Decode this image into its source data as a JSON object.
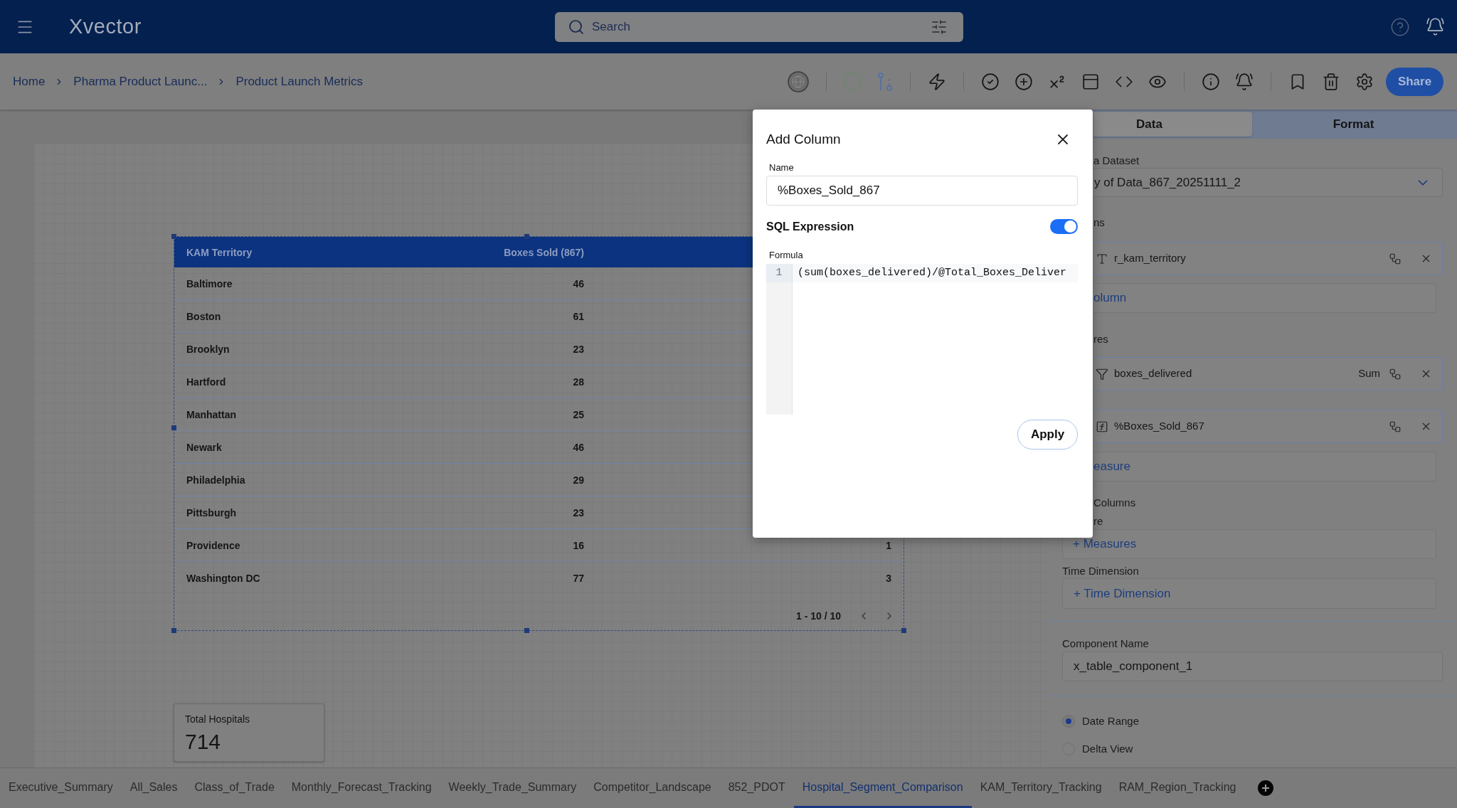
{
  "top_bar": {
    "logo": "Xvector",
    "search": {
      "placeholder": "Search"
    }
  },
  "breadcrumbs": [
    {
      "label": "Home"
    },
    {
      "label": "Pharma Product Launc..."
    },
    {
      "label": "Product Launch Metrics"
    }
  ],
  "toolbar": {
    "share_label": "Share"
  },
  "table": {
    "columns": [
      "KAM Territory",
      "Boxes Sold (867)"
    ],
    "rows": [
      {
        "cells": [
          "Baltimore",
          "46"
        ]
      },
      {
        "cells": [
          "Boston",
          "61"
        ]
      },
      {
        "cells": [
          "Brooklyn",
          "23"
        ]
      },
      {
        "cells": [
          "Hartford",
          "28"
        ]
      },
      {
        "cells": [
          "Manhattan",
          "25"
        ]
      },
      {
        "cells": [
          "Newark",
          "46"
        ]
      },
      {
        "cells": [
          "Philadelphia",
          "29"
        ]
      },
      {
        "cells": [
          "Pittsburgh",
          "23"
        ]
      },
      {
        "cells": [
          "Providence",
          "16",
          "1"
        ]
      },
      {
        "cells": [
          "Washington DC",
          "77",
          "3"
        ]
      }
    ],
    "pagination": "1 - 10 / 10"
  },
  "kpi_card": {
    "title": "Total Hospitals",
    "value": "714"
  },
  "dialog": {
    "title": "Add Column",
    "name_label": "Name",
    "name_value": "%Boxes_Sold_867",
    "sql_label": "SQL Expression",
    "sql_enabled": true,
    "formula_label": "Formula",
    "formula_lines": [
      {
        "number": "1",
        "code": "(sum(boxes_delivered)/@Total_Boxes_Deliver"
      }
    ],
    "apply_label": "Apply"
  },
  "panel": {
    "tabs": [
      {
        "label": "Data",
        "selected": true
      },
      {
        "label": "Format",
        "selected": false
      }
    ],
    "dataset_label": "a Dataset",
    "dataset_value": "y of Data_867_20251111_2",
    "columns_label": "ns",
    "columns": [
      {
        "kind": "dimension",
        "name": "r_kam_territory"
      }
    ],
    "add_column": "olumn",
    "measures_label": "res",
    "measures": [
      {
        "kind": "measure",
        "name": "boxes_delivered",
        "aggregation": "Sum"
      },
      {
        "kind": "calculated",
        "name": "%Boxes_Sold_867"
      }
    ],
    "add_measure": "easure",
    "custom_label": "Columns",
    "custom_sublabel": "re",
    "add_custom": "+ Measures",
    "time_label": "Time Dimension",
    "add_time": "+ Time Dimension",
    "component_label": "Component Name",
    "component_value": "x_table_component_1",
    "view_options": [
      {
        "label": "Date Range",
        "selected": true
      },
      {
        "label": "Delta View",
        "selected": false
      }
    ]
  },
  "sheet_tabs": [
    {
      "label": "Executive_Summary",
      "selected": false
    },
    {
      "label": "All_Sales",
      "selected": false
    },
    {
      "label": "Class_of_Trade",
      "selected": false
    },
    {
      "label": "Monthly_Forecast_Tracking",
      "selected": false
    },
    {
      "label": "Weekly_Trade_Summary",
      "selected": false
    },
    {
      "label": "Competitor_Landscape",
      "selected": false
    },
    {
      "label": "852_PDOT",
      "selected": false
    },
    {
      "label": "Hospital_Segment_Comparison",
      "selected": true
    },
    {
      "label": "KAM_Territory_Tracking",
      "selected": false
    },
    {
      "label": "RAM_Region_Tracking",
      "selected": false
    }
  ]
}
